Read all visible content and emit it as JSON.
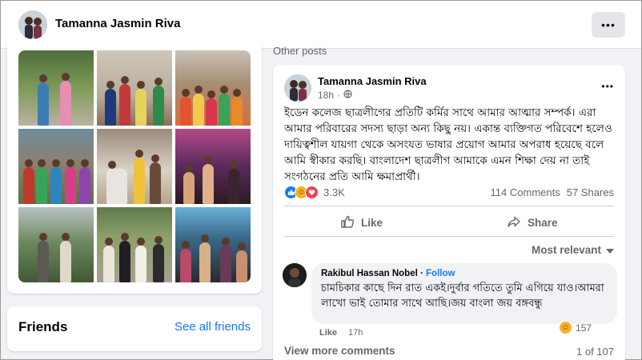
{
  "profile": {
    "name": "Tamanna Jasmin Riva"
  },
  "header": {
    "more_icon": "ellipsis-icon"
  },
  "photos": {
    "count": 9
  },
  "friends": {
    "title": "Friends",
    "see_all": "See all friends"
  },
  "section": {
    "other_posts": "Other posts"
  },
  "post": {
    "author": "Tamanna Jasmin Riva",
    "time": "18h",
    "privacy_icon": "globe-icon",
    "text": "ইডেন কলেজ ছাত্রলীগের প্রতিটি কর্মির সাথে আমার আত্মার সম্পর্ক। এরা আমার পরিবারের সদস্য ছাড়া অন্য কিছু নয়। একান্ত ব্যক্তিগত পরিবেশে হলেও দায়িত্বশীল যায়গা থেকে অসংযত ভাষার প্রয়োগ আমার অপরাধ হয়েছে বলে আমি স্বীকার করছি। বাংলাদেশ ছাত্রলীগ আমাকে এমন শিক্ষা দেয় না তাই সংগঠনের প্রতি আমি ক্ষমাপ্রার্থী।",
    "reaction_count": "3.3K",
    "reaction_icons": [
      "like-icon",
      "haha-icon",
      "love-icon"
    ],
    "comments": "114 Comments",
    "shares": "57 Shares",
    "like_label": "Like",
    "share_label": "Share"
  },
  "comments": {
    "sort_label": "Most relevant",
    "items": [
      {
        "author": "Rakibul Hassan Nobel",
        "follow": "Follow",
        "text": "চামচিকার কাছে দিন রাত একই।দুর্বার গতিতে তুমি এগিয়ে যাও।আমরা লাখো ভাই তোমার সাথে আছি।জয় বাংলা জয় বঙ্গবন্ধু",
        "like_label": "Like",
        "time": "17h",
        "reaction_count": "157",
        "reaction_icon": "haha-icon"
      }
    ],
    "view_more": "View more comments",
    "pager": "1 of 107"
  }
}
